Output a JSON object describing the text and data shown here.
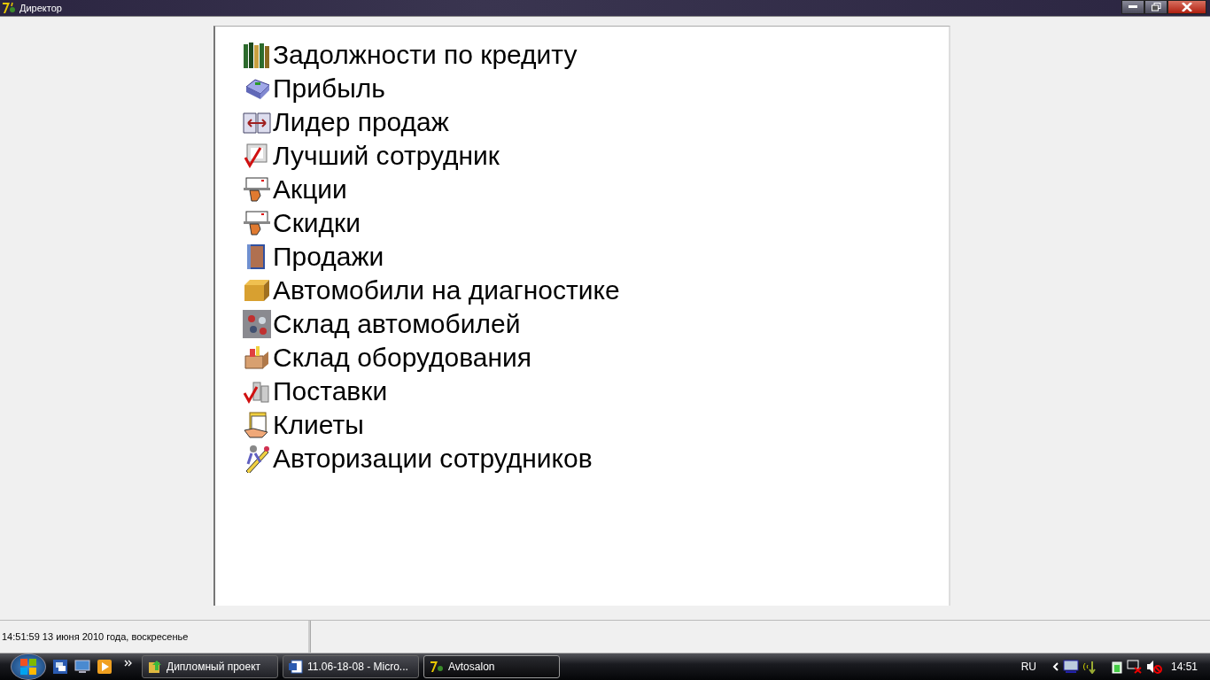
{
  "window": {
    "title": "Директор"
  },
  "menu": {
    "items": [
      {
        "label": "Задолжности по кредиту"
      },
      {
        "label": "Прибыль"
      },
      {
        "label": "Лидер продаж"
      },
      {
        "label": "Лучший сотрудник"
      },
      {
        "label": "Акции"
      },
      {
        "label": "Скидки"
      },
      {
        "label": "Продажи"
      },
      {
        "label": "Автомобили на диагностике"
      },
      {
        "label": "Склад автомобилей"
      },
      {
        "label": "Склад оборудования"
      },
      {
        "label": "Поставки"
      },
      {
        "label": "Клиеты"
      },
      {
        "label": "Авторизации сотрудников"
      }
    ]
  },
  "status_bar": {
    "datetime": "14:51:59  13 июня 2010 года, воскресенье"
  },
  "taskbar": {
    "buttons": [
      {
        "label": "Дипломный проект",
        "selected": false
      },
      {
        "label": "11.06-18-08 - Micro...",
        "selected": false
      },
      {
        "label": "Avtosalon",
        "selected": true
      }
    ],
    "language": "RU",
    "clock": "14:51"
  }
}
